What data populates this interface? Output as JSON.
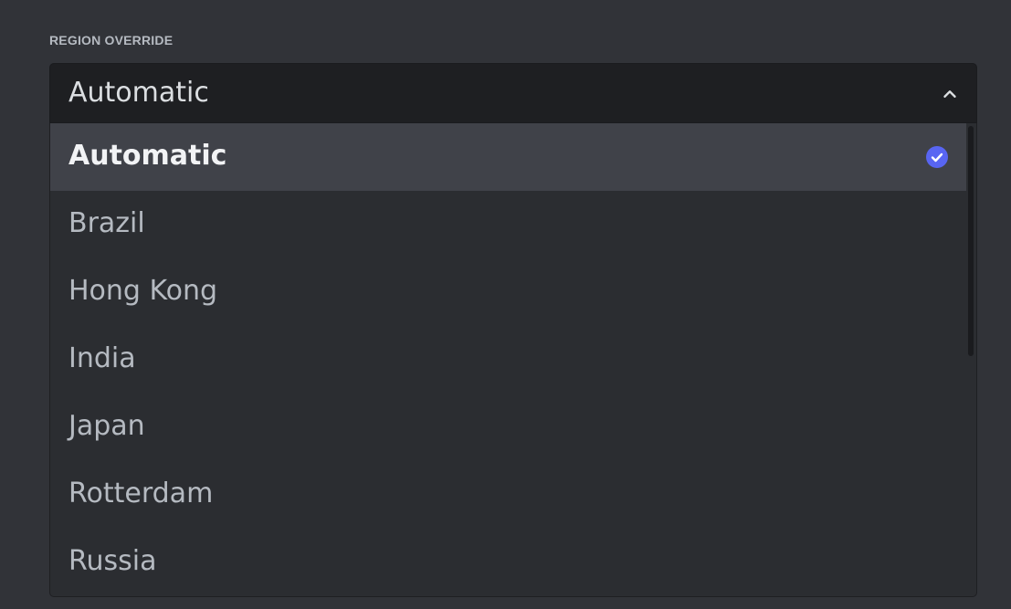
{
  "field": {
    "label": "REGION OVERRIDE",
    "selected_value": "Automatic",
    "chevron_icon": "chevron-up-icon"
  },
  "options": [
    {
      "label": "Automatic",
      "selected": true
    },
    {
      "label": "Brazil",
      "selected": false
    },
    {
      "label": "Hong Kong",
      "selected": false
    },
    {
      "label": "India",
      "selected": false
    },
    {
      "label": "Japan",
      "selected": false
    },
    {
      "label": "Rotterdam",
      "selected": false
    },
    {
      "label": "Russia",
      "selected": false
    }
  ],
  "check_icon": "check-circle-icon",
  "colors": {
    "background": "#313338",
    "control_bg": "#1e1f22",
    "menu_bg": "#2b2d31",
    "selected_bg": "#404249",
    "accent": "#5865f2"
  }
}
